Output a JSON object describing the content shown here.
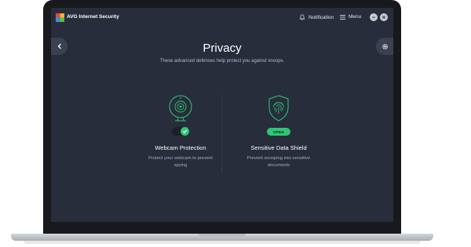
{
  "app": {
    "title": "AVG Internet Security"
  },
  "titlebar": {
    "notification_label": "Notification",
    "menu_label": "Menu"
  },
  "page": {
    "title": "Privacy",
    "subtitle": "These advanced defenses help protect you against snoops."
  },
  "features": [
    {
      "title": "Webcam Protection",
      "description": "Protect your webcam to prevent spying",
      "icon": "webcam-icon",
      "control": "toggle",
      "enabled": true
    },
    {
      "title": "Sensitive Data Shield",
      "description": "Prevent snooping into sensitive documents",
      "icon": "fingerprint-shield-icon",
      "control_label": "OPEN"
    }
  ],
  "colors": {
    "accent": "#2fc774",
    "background": "#272d3b",
    "frame": "#17191c"
  }
}
